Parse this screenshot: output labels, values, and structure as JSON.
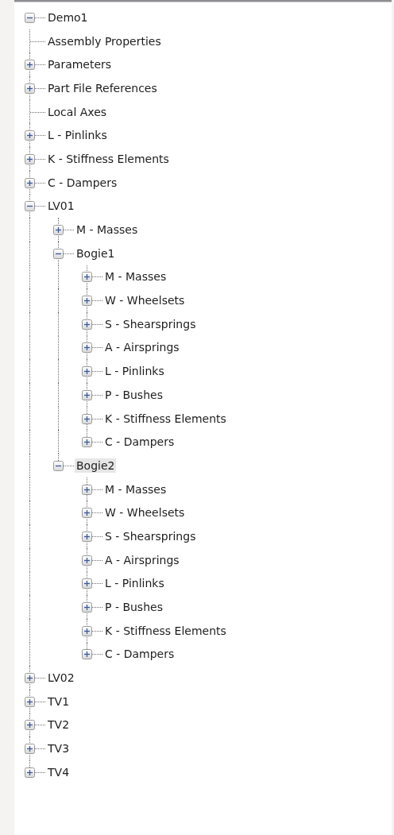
{
  "tree": {
    "nodes": [
      {
        "label": "Demo1",
        "kind": "branch",
        "expanded": true,
        "selected": false,
        "children": [
          {
            "label": "Assembly Properties",
            "kind": "leaf",
            "selected": false
          },
          {
            "label": "Parameters",
            "kind": "branch",
            "expanded": false,
            "selected": false
          },
          {
            "label": "Part File References",
            "kind": "branch",
            "expanded": false,
            "selected": false
          },
          {
            "label": "Local Axes",
            "kind": "leaf",
            "selected": false
          },
          {
            "label": "L - Pinlinks",
            "kind": "branch",
            "expanded": false,
            "selected": false
          },
          {
            "label": "K - Stiffness Elements",
            "kind": "branch",
            "expanded": false,
            "selected": false
          },
          {
            "label": "C - Dampers",
            "kind": "branch",
            "expanded": false,
            "selected": false
          },
          {
            "label": "LV01",
            "kind": "branch",
            "expanded": true,
            "selected": false,
            "children": [
              {
                "label": "M - Masses",
                "kind": "branch",
                "expanded": false,
                "selected": false
              },
              {
                "label": "Bogie1",
                "kind": "branch",
                "expanded": true,
                "selected": false,
                "children": [
                  {
                    "label": "M - Masses",
                    "kind": "branch",
                    "expanded": false,
                    "selected": false
                  },
                  {
                    "label": "W - Wheelsets",
                    "kind": "branch",
                    "expanded": false,
                    "selected": false
                  },
                  {
                    "label": "S - Shearsprings",
                    "kind": "branch",
                    "expanded": false,
                    "selected": false
                  },
                  {
                    "label": "A - Airsprings",
                    "kind": "branch",
                    "expanded": false,
                    "selected": false
                  },
                  {
                    "label": "L - Pinlinks",
                    "kind": "branch",
                    "expanded": false,
                    "selected": false
                  },
                  {
                    "label": "P - Bushes",
                    "kind": "branch",
                    "expanded": false,
                    "selected": false
                  },
                  {
                    "label": "K - Stiffness Elements",
                    "kind": "branch",
                    "expanded": false,
                    "selected": false
                  },
                  {
                    "label": "C - Dampers",
                    "kind": "branch",
                    "expanded": false,
                    "selected": false
                  }
                ]
              },
              {
                "label": "Bogie2",
                "kind": "branch",
                "expanded": true,
                "selected": true,
                "children": [
                  {
                    "label": "M - Masses",
                    "kind": "branch",
                    "expanded": false,
                    "selected": false
                  },
                  {
                    "label": "W - Wheelsets",
                    "kind": "branch",
                    "expanded": false,
                    "selected": false
                  },
                  {
                    "label": "S - Shearsprings",
                    "kind": "branch",
                    "expanded": false,
                    "selected": false
                  },
                  {
                    "label": "A - Airsprings",
                    "kind": "branch",
                    "expanded": false,
                    "selected": false
                  },
                  {
                    "label": "L - Pinlinks",
                    "kind": "branch",
                    "expanded": false,
                    "selected": false
                  },
                  {
                    "label": "P - Bushes",
                    "kind": "branch",
                    "expanded": false,
                    "selected": false
                  },
                  {
                    "label": "K - Stiffness Elements",
                    "kind": "branch",
                    "expanded": false,
                    "selected": false
                  },
                  {
                    "label": "C - Dampers",
                    "kind": "branch",
                    "expanded": false,
                    "selected": false
                  }
                ]
              }
            ]
          },
          {
            "label": "LV02",
            "kind": "branch",
            "expanded": false,
            "selected": false
          },
          {
            "label": "TV1",
            "kind": "branch",
            "expanded": false,
            "selected": false
          },
          {
            "label": "TV2",
            "kind": "branch",
            "expanded": false,
            "selected": false
          },
          {
            "label": "TV3",
            "kind": "branch",
            "expanded": false,
            "selected": false
          },
          {
            "label": "TV4",
            "kind": "branch",
            "expanded": false,
            "selected": false
          }
        ]
      }
    ]
  }
}
